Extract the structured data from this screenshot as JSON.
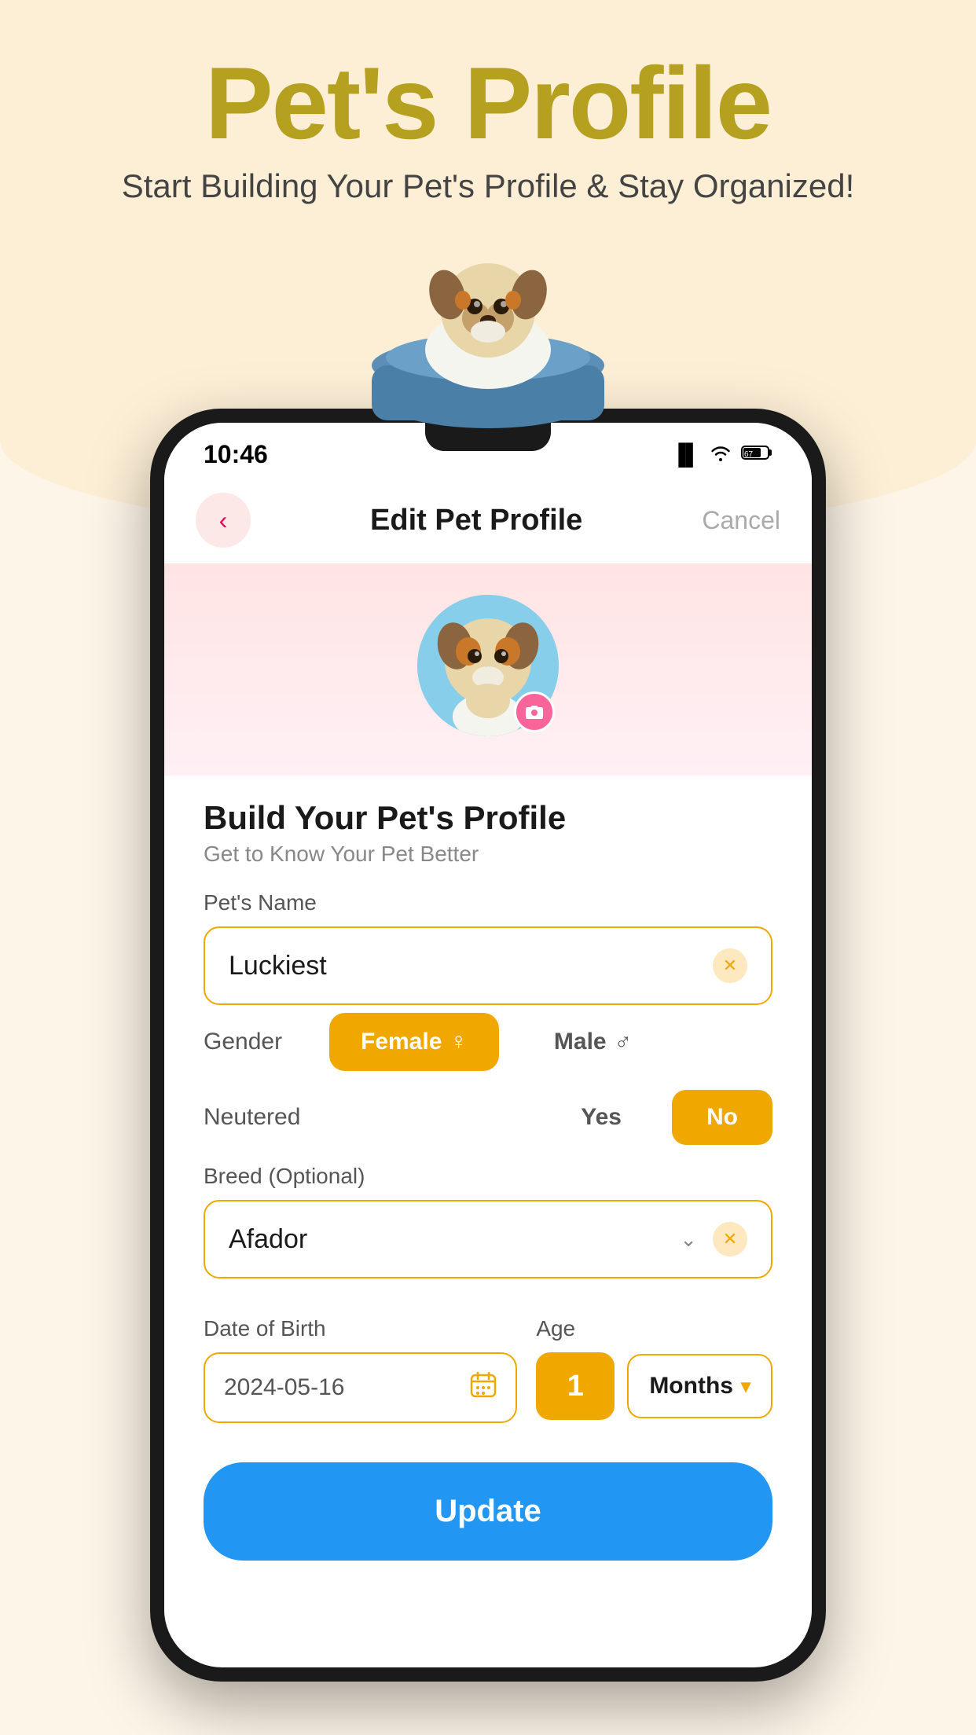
{
  "header": {
    "title": "Pet's Profile",
    "subtitle": "Start Building Your Pet's Profile & Stay Organized!"
  },
  "statusBar": {
    "time": "10:46",
    "batteryLevel": "67"
  },
  "nav": {
    "title": "Edit Pet Profile",
    "cancelLabel": "Cancel"
  },
  "profile": {
    "sectionTitle": "Build Your Pet's Profile",
    "sectionSub": "Get to Know Your Pet Better"
  },
  "form": {
    "petNameLabel": "Pet's Name",
    "petNameValue": "Luckiest",
    "genderLabel": "Gender",
    "genderFemale": "Female",
    "genderMale": "Male",
    "neuteredLabel": "Neutered",
    "neuteredYes": "Yes",
    "neuteredNo": "No",
    "breedLabel": "Breed (Optional)",
    "breedValue": "Afador",
    "dobLabel": "Date of Birth",
    "dobValue": "2024-05-16",
    "ageLabel": "Age",
    "ageValue": "1",
    "ageUnit": "Months",
    "updateBtn": "Update"
  },
  "colors": {
    "accent": "#f0a800",
    "primary": "#2196f3",
    "titleColor": "#b5a020"
  }
}
